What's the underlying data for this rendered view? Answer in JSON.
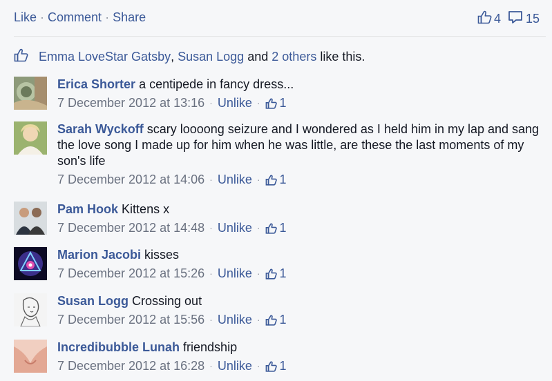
{
  "actions": {
    "like": "Like",
    "comment": "Comment",
    "share": "Share",
    "sep": "·"
  },
  "counts": {
    "likes": "4",
    "comments": "15"
  },
  "likes_summary": {
    "name1": "Emma LoveStar Gatsby",
    "comma": ",",
    "name2": "Susan Logg",
    "and": "and",
    "others": "2 others",
    "suffix": "like this."
  },
  "comments": [
    {
      "author": "Erica Shorter",
      "text": "a centipede in fancy dress...",
      "time": "7 December 2012 at 13:16",
      "unlike": "Unlike",
      "likes": "1",
      "avatar_icon": "profile-photo-icon"
    },
    {
      "author": "Sarah Wyckoff",
      "text": "scary loooong seizure and I wondered as I held him in my lap and sang the love song I made up for him when he was little, are these the last moments of my son's life",
      "time": "7 December 2012 at 14:06",
      "unlike": "Unlike",
      "likes": "1",
      "avatar_icon": "profile-photo-icon"
    },
    {
      "author": "Pam Hook",
      "text": "Kittens x",
      "time": "7 December 2012 at 14:48",
      "unlike": "Unlike",
      "likes": "1",
      "avatar_icon": "profile-photo-icon"
    },
    {
      "author": "Marion Jacobi",
      "text": "kisses",
      "time": "7 December 2012 at 15:26",
      "unlike": "Unlike",
      "likes": "1",
      "avatar_icon": "profile-photo-icon"
    },
    {
      "author": "Susan Logg",
      "text": "Crossing out",
      "time": "7 December 2012 at 15:56",
      "unlike": "Unlike",
      "likes": "1",
      "avatar_icon": "profile-photo-icon"
    },
    {
      "author": "Incredibubble Lunah",
      "text": "friendship",
      "time": "7 December 2012 at 16:28",
      "unlike": "Unlike",
      "likes": "1",
      "avatar_icon": "profile-photo-icon"
    }
  ],
  "meta_sep": "·",
  "colors": {
    "link": "#3b5998",
    "meta": "#6a7180",
    "background": "#f6f7f9"
  }
}
